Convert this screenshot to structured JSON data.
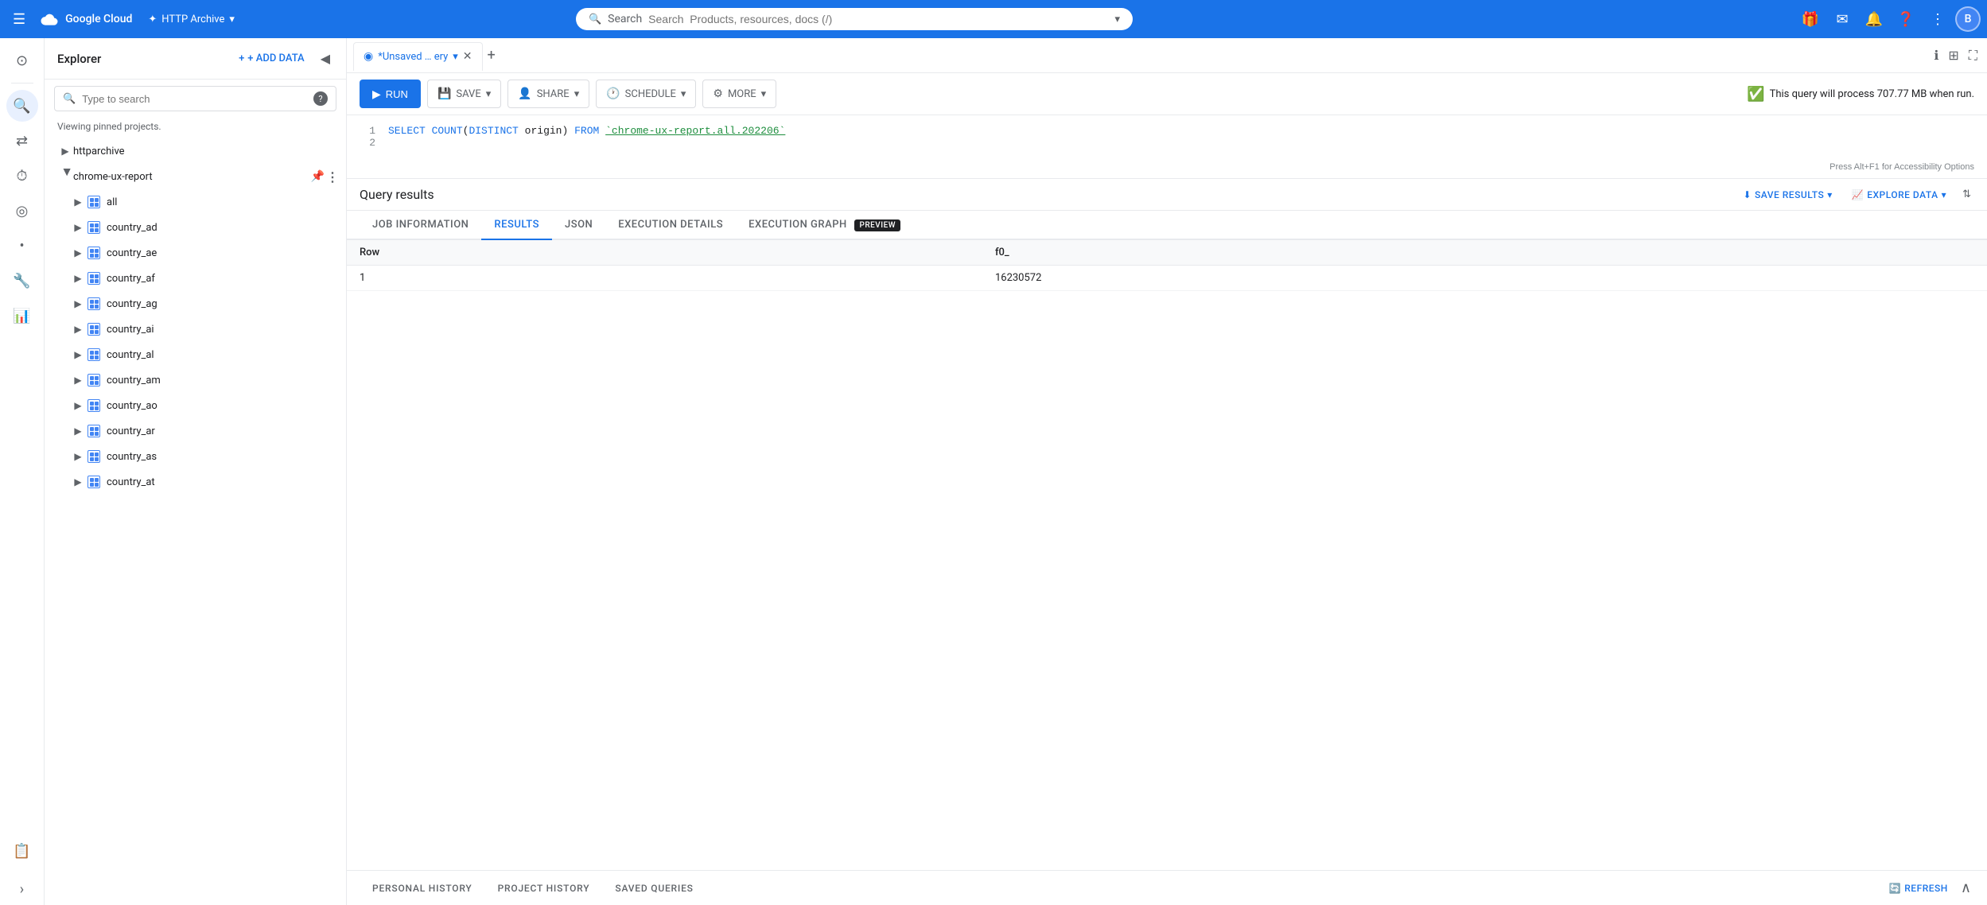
{
  "topNav": {
    "hamburger": "☰",
    "googleCloud": "Google Cloud",
    "project": "HTTP Archive",
    "searchPlaceholder": "Search  Products, resources, docs (/)",
    "avatarLabel": "B"
  },
  "iconNav": {
    "items": [
      {
        "name": "home-icon",
        "icon": "⊙",
        "active": false
      },
      {
        "name": "search-icon",
        "icon": "🔍",
        "active": true
      },
      {
        "name": "transfer-icon",
        "icon": "⇄",
        "active": false
      },
      {
        "name": "history-icon",
        "icon": "🕐",
        "active": false
      },
      {
        "name": "schema-icon",
        "icon": "⊗",
        "active": false
      },
      {
        "name": "dot-icon",
        "icon": "•",
        "active": false
      },
      {
        "name": "tools-icon",
        "icon": "🔧",
        "active": false
      },
      {
        "name": "chart-icon",
        "icon": "📊",
        "active": false
      },
      {
        "name": "doc-icon",
        "icon": "📋",
        "active": false
      }
    ]
  },
  "explorer": {
    "title": "Explorer",
    "addDataLabel": "+ ADD DATA",
    "searchPlaceholder": "Type to search",
    "viewingText": "Viewing pinned projects.",
    "tree": [
      {
        "id": "httparchive",
        "label": "httparchive",
        "level": 0,
        "expanded": false,
        "type": "project"
      },
      {
        "id": "chrome-ux-report",
        "label": "chrome-ux-report",
        "level": 0,
        "expanded": true,
        "type": "project",
        "pinned": true
      },
      {
        "id": "all",
        "label": "all",
        "level": 1,
        "expanded": false,
        "type": "dataset"
      },
      {
        "id": "country_ad",
        "label": "country_ad",
        "level": 1,
        "expanded": false,
        "type": "dataset"
      },
      {
        "id": "country_ae",
        "label": "country_ae",
        "level": 1,
        "expanded": false,
        "type": "dataset"
      },
      {
        "id": "country_af",
        "label": "country_af",
        "level": 1,
        "expanded": false,
        "type": "dataset"
      },
      {
        "id": "country_ag",
        "label": "country_ag",
        "level": 1,
        "expanded": false,
        "type": "dataset"
      },
      {
        "id": "country_ai",
        "label": "country_ai",
        "level": 1,
        "expanded": false,
        "type": "dataset"
      },
      {
        "id": "country_al",
        "label": "country_al",
        "level": 1,
        "expanded": false,
        "type": "dataset"
      },
      {
        "id": "country_am",
        "label": "country_am",
        "level": 1,
        "expanded": false,
        "type": "dataset"
      },
      {
        "id": "country_ao",
        "label": "country_ao",
        "level": 1,
        "expanded": false,
        "type": "dataset"
      },
      {
        "id": "country_ar",
        "label": "country_ar",
        "level": 1,
        "expanded": false,
        "type": "dataset"
      },
      {
        "id": "country_as",
        "label": "country_as",
        "level": 1,
        "expanded": false,
        "type": "dataset"
      },
      {
        "id": "country_at",
        "label": "country_at",
        "level": 1,
        "expanded": false,
        "type": "dataset"
      }
    ]
  },
  "queryEditor": {
    "tabLabel": "*Unsaved … ery",
    "sql": {
      "line1": "SELECT COUNT(DISTINCT origin) FROM `chrome-ux-report.all.202206`",
      "line2": ""
    },
    "hint": "Press Alt+F1 for Accessibility Options"
  },
  "toolbar": {
    "runLabel": "RUN",
    "saveLabel": "SAVE",
    "shareLabel": "SHARE",
    "scheduleLabel": "SCHEDULE",
    "moreLabel": "MORE",
    "queryInfo": "This query will process 707.77 MB when run."
  },
  "results": {
    "title": "Query results",
    "saveResultsLabel": "SAVE RESULTS",
    "exploreDataLabel": "EXPLORE DATA",
    "tabs": [
      {
        "id": "job-info",
        "label": "JOB INFORMATION",
        "active": false
      },
      {
        "id": "results",
        "label": "RESULTS",
        "active": true
      },
      {
        "id": "json",
        "label": "JSON",
        "active": false
      },
      {
        "id": "exec-details",
        "label": "EXECUTION DETAILS",
        "active": false
      },
      {
        "id": "exec-graph",
        "label": "EXECUTION GRAPH",
        "active": false,
        "badge": "PREVIEW"
      }
    ],
    "table": {
      "columns": [
        "Row",
        "f0_"
      ],
      "rows": [
        {
          "row": "1",
          "f0": "16230572"
        }
      ]
    }
  },
  "history": {
    "tabs": [
      {
        "id": "personal",
        "label": "PERSONAL HISTORY"
      },
      {
        "id": "project",
        "label": "PROJECT HISTORY"
      },
      {
        "id": "saved",
        "label": "SAVED QUERIES"
      }
    ],
    "refreshLabel": "REFRESH"
  }
}
